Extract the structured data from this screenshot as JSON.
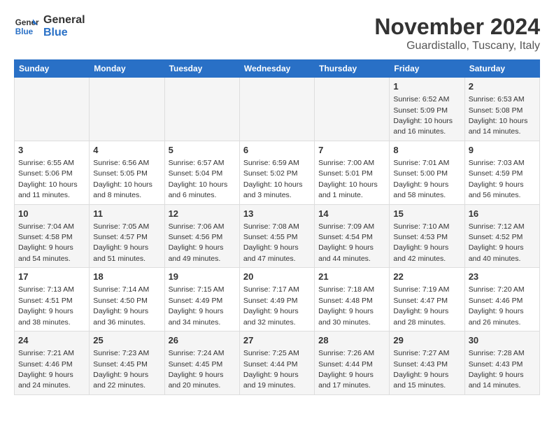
{
  "header": {
    "logo_line1": "General",
    "logo_line2": "Blue",
    "month": "November 2024",
    "location": "Guardistallo, Tuscany, Italy"
  },
  "weekdays": [
    "Sunday",
    "Monday",
    "Tuesday",
    "Wednesday",
    "Thursday",
    "Friday",
    "Saturday"
  ],
  "weeks": [
    [
      {
        "day": "",
        "info": ""
      },
      {
        "day": "",
        "info": ""
      },
      {
        "day": "",
        "info": ""
      },
      {
        "day": "",
        "info": ""
      },
      {
        "day": "",
        "info": ""
      },
      {
        "day": "1",
        "info": "Sunrise: 6:52 AM\nSunset: 5:09 PM\nDaylight: 10 hours and 16 minutes."
      },
      {
        "day": "2",
        "info": "Sunrise: 6:53 AM\nSunset: 5:08 PM\nDaylight: 10 hours and 14 minutes."
      }
    ],
    [
      {
        "day": "3",
        "info": "Sunrise: 6:55 AM\nSunset: 5:06 PM\nDaylight: 10 hours and 11 minutes."
      },
      {
        "day": "4",
        "info": "Sunrise: 6:56 AM\nSunset: 5:05 PM\nDaylight: 10 hours and 8 minutes."
      },
      {
        "day": "5",
        "info": "Sunrise: 6:57 AM\nSunset: 5:04 PM\nDaylight: 10 hours and 6 minutes."
      },
      {
        "day": "6",
        "info": "Sunrise: 6:59 AM\nSunset: 5:02 PM\nDaylight: 10 hours and 3 minutes."
      },
      {
        "day": "7",
        "info": "Sunrise: 7:00 AM\nSunset: 5:01 PM\nDaylight: 10 hours and 1 minute."
      },
      {
        "day": "8",
        "info": "Sunrise: 7:01 AM\nSunset: 5:00 PM\nDaylight: 9 hours and 58 minutes."
      },
      {
        "day": "9",
        "info": "Sunrise: 7:03 AM\nSunset: 4:59 PM\nDaylight: 9 hours and 56 minutes."
      }
    ],
    [
      {
        "day": "10",
        "info": "Sunrise: 7:04 AM\nSunset: 4:58 PM\nDaylight: 9 hours and 54 minutes."
      },
      {
        "day": "11",
        "info": "Sunrise: 7:05 AM\nSunset: 4:57 PM\nDaylight: 9 hours and 51 minutes."
      },
      {
        "day": "12",
        "info": "Sunrise: 7:06 AM\nSunset: 4:56 PM\nDaylight: 9 hours and 49 minutes."
      },
      {
        "day": "13",
        "info": "Sunrise: 7:08 AM\nSunset: 4:55 PM\nDaylight: 9 hours and 47 minutes."
      },
      {
        "day": "14",
        "info": "Sunrise: 7:09 AM\nSunset: 4:54 PM\nDaylight: 9 hours and 44 minutes."
      },
      {
        "day": "15",
        "info": "Sunrise: 7:10 AM\nSunset: 4:53 PM\nDaylight: 9 hours and 42 minutes."
      },
      {
        "day": "16",
        "info": "Sunrise: 7:12 AM\nSunset: 4:52 PM\nDaylight: 9 hours and 40 minutes."
      }
    ],
    [
      {
        "day": "17",
        "info": "Sunrise: 7:13 AM\nSunset: 4:51 PM\nDaylight: 9 hours and 38 minutes."
      },
      {
        "day": "18",
        "info": "Sunrise: 7:14 AM\nSunset: 4:50 PM\nDaylight: 9 hours and 36 minutes."
      },
      {
        "day": "19",
        "info": "Sunrise: 7:15 AM\nSunset: 4:49 PM\nDaylight: 9 hours and 34 minutes."
      },
      {
        "day": "20",
        "info": "Sunrise: 7:17 AM\nSunset: 4:49 PM\nDaylight: 9 hours and 32 minutes."
      },
      {
        "day": "21",
        "info": "Sunrise: 7:18 AM\nSunset: 4:48 PM\nDaylight: 9 hours and 30 minutes."
      },
      {
        "day": "22",
        "info": "Sunrise: 7:19 AM\nSunset: 4:47 PM\nDaylight: 9 hours and 28 minutes."
      },
      {
        "day": "23",
        "info": "Sunrise: 7:20 AM\nSunset: 4:46 PM\nDaylight: 9 hours and 26 minutes."
      }
    ],
    [
      {
        "day": "24",
        "info": "Sunrise: 7:21 AM\nSunset: 4:46 PM\nDaylight: 9 hours and 24 minutes."
      },
      {
        "day": "25",
        "info": "Sunrise: 7:23 AM\nSunset: 4:45 PM\nDaylight: 9 hours and 22 minutes."
      },
      {
        "day": "26",
        "info": "Sunrise: 7:24 AM\nSunset: 4:45 PM\nDaylight: 9 hours and 20 minutes."
      },
      {
        "day": "27",
        "info": "Sunrise: 7:25 AM\nSunset: 4:44 PM\nDaylight: 9 hours and 19 minutes."
      },
      {
        "day": "28",
        "info": "Sunrise: 7:26 AM\nSunset: 4:44 PM\nDaylight: 9 hours and 17 minutes."
      },
      {
        "day": "29",
        "info": "Sunrise: 7:27 AM\nSunset: 4:43 PM\nDaylight: 9 hours and 15 minutes."
      },
      {
        "day": "30",
        "info": "Sunrise: 7:28 AM\nSunset: 4:43 PM\nDaylight: 9 hours and 14 minutes."
      }
    ]
  ]
}
